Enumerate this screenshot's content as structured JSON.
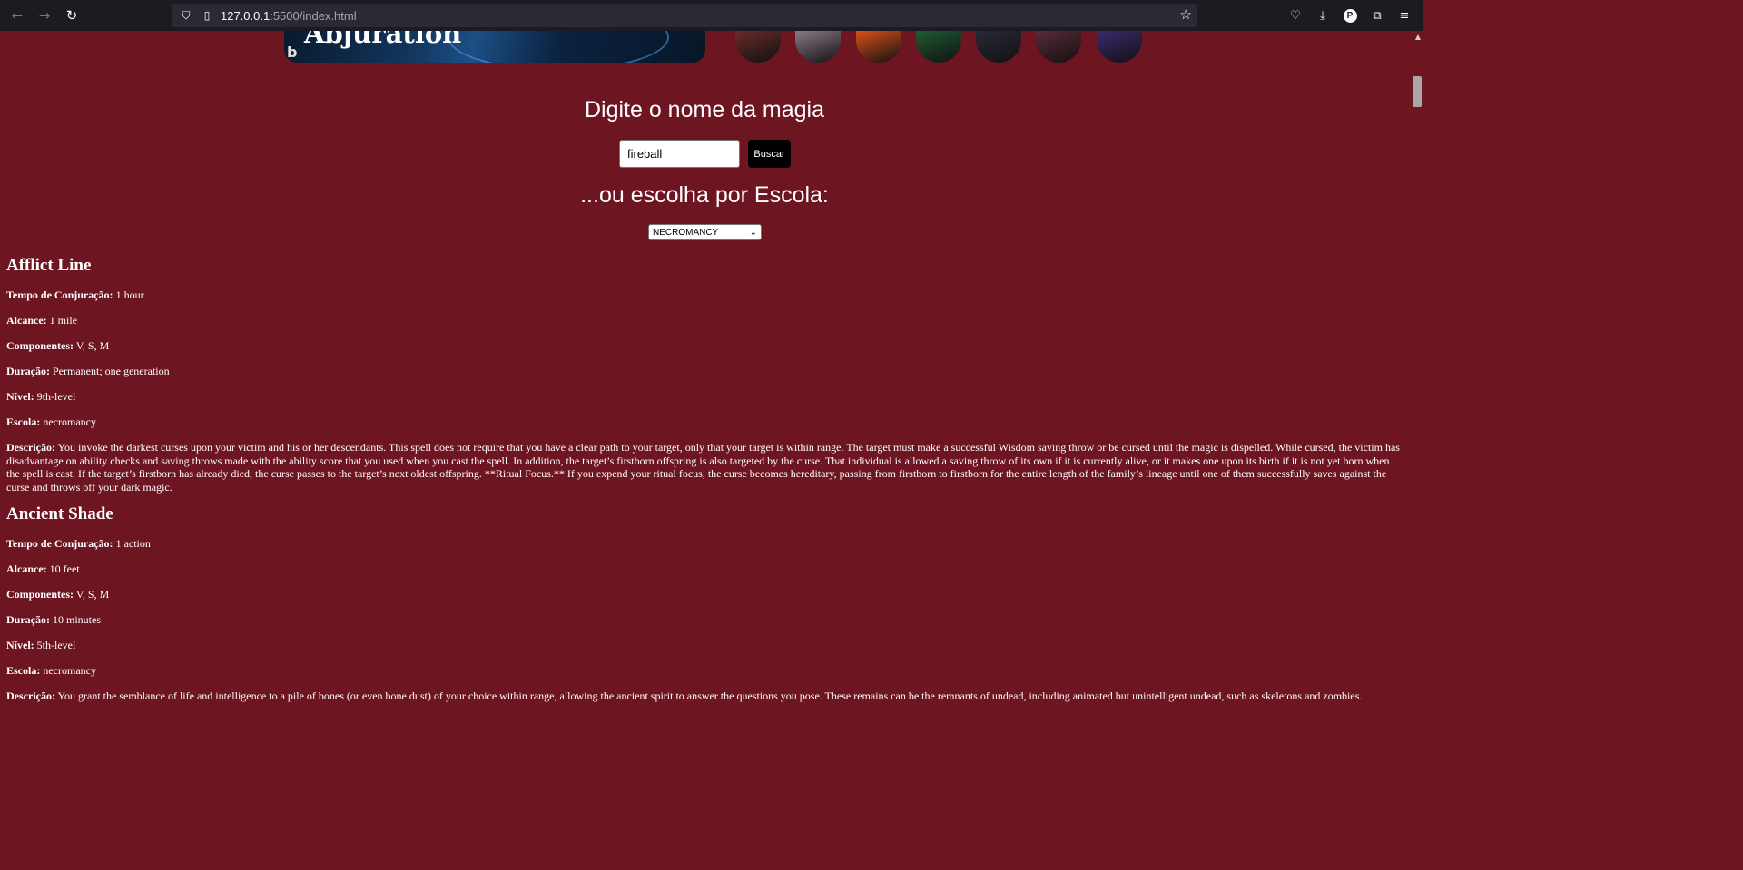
{
  "browser": {
    "url_host": "127.0.0.1",
    "url_path": ":5500/index.html",
    "icons": [
      "back-arrow-icon",
      "forward-arrow-icon",
      "reload-icon",
      "shield-icon",
      "page-icon",
      "star-icon",
      "pocket-icon",
      "download-icon",
      "profile-icon",
      "extensions-icon",
      "menu-icon"
    ],
    "profile_letter": "P"
  },
  "hero": {
    "title": "Abjuration",
    "thumb_colors": [
      "#6b2a2a",
      "#8a7a88",
      "#d8501a",
      "#1e5a32",
      "#2a2838",
      "#5a2a38",
      "#3a2a6e"
    ]
  },
  "search": {
    "title": "Digite o nome da magia",
    "input_value": "fireball",
    "button_label": "Buscar",
    "school_title": "...ou escolha por Escola:",
    "school_selected": "NECROMANCY"
  },
  "labels": {
    "casting_time": "Tempo de Conjuração:",
    "range": "Alcance:",
    "components": "Componentes:",
    "duration": "Duração:",
    "level": "Nível:",
    "school": "Escola:",
    "description": "Descrição:"
  },
  "spells": [
    {
      "name": "Afflict Line",
      "casting_time": "1 hour",
      "range": "1 mile",
      "components": "V, S, M",
      "duration": "Permanent; one generation",
      "level": "9th-level",
      "school": "necromancy",
      "description": "You invoke the darkest curses upon your victim and his or her descendants. This spell does not require that you have a clear path to your target, only that your target is within range. The target must make a successful Wisdom saving throw or be cursed until the magic is dispelled. While cursed, the victim has disadvantage on ability checks and saving throws made with the ability score that you used when you cast the spell. In addition, the target’s firstborn offspring is also targeted by the curse. That individual is allowed a saving throw of its own if it is currently alive, or it makes one upon its birth if it is not yet born when the spell is cast. If the target’s firstborn has already died, the curse passes to the target’s next oldest offspring. **Ritual Focus.** If you expend your ritual focus, the curse becomes hereditary, passing from firstborn to firstborn for the entire length of the family’s lineage until one of them successfully saves against the curse and throws off your dark magic."
    },
    {
      "name": "Ancient Shade",
      "casting_time": "1 action",
      "range": "10 feet",
      "components": "V, S, M",
      "duration": "10 minutes",
      "level": "5th-level",
      "school": "necromancy",
      "description": "You grant the semblance of life and intelligence to a pile of bones (or even bone dust) of your choice within range, allowing the ancient spirit to answer the questions you pose. These remains can be the remnants of undead, including animated but unintelligent undead, such as skeletons and zombies."
    }
  ]
}
